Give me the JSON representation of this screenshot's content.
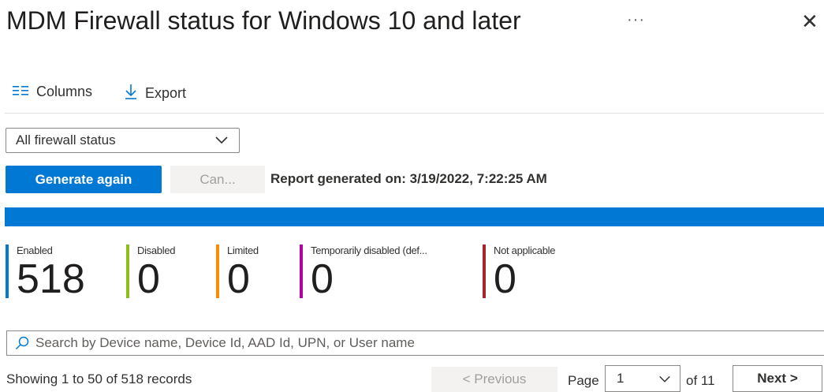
{
  "header": {
    "title": "MDM Firewall status for Windows 10 and later",
    "more": "···",
    "close": "✕"
  },
  "toolbar": {
    "columns_label": "Columns",
    "columns_icon": "columns-icon",
    "export_label": "Export",
    "export_icon": "download-arrow-icon"
  },
  "filter": {
    "selected": "All firewall status"
  },
  "actions": {
    "generate_label": "Generate again",
    "cancel_label": "Can...",
    "report_text": "Report generated on: 3/19/2022, 7:22:25 AM"
  },
  "progress": {
    "fraction": 1.0,
    "color": "#0078d4"
  },
  "stats": [
    {
      "label": "Enabled",
      "value": "518",
      "color": "#0078d4"
    },
    {
      "label": "Disabled",
      "value": "0",
      "color": "#8cbd18"
    },
    {
      "label": "Limited",
      "value": "0",
      "color": "#ff8c00"
    },
    {
      "label": "Temporarily disabled (def...",
      "value": "0",
      "color": "#b4009e"
    },
    {
      "label": "Not applicable",
      "value": "0",
      "color": "#a4262c"
    }
  ],
  "search": {
    "placeholder": "Search by Device name, Device Id, AAD Id, UPN, or User name",
    "icon": "search-icon"
  },
  "pagination": {
    "showing": "Showing 1 to 50 of 518 records",
    "previous_label": "< Previous",
    "page_label": "Page",
    "page_value": "1",
    "of_label": "of 11",
    "next_label": "Next >"
  },
  "colors": {
    "accent": "#0078d4"
  }
}
